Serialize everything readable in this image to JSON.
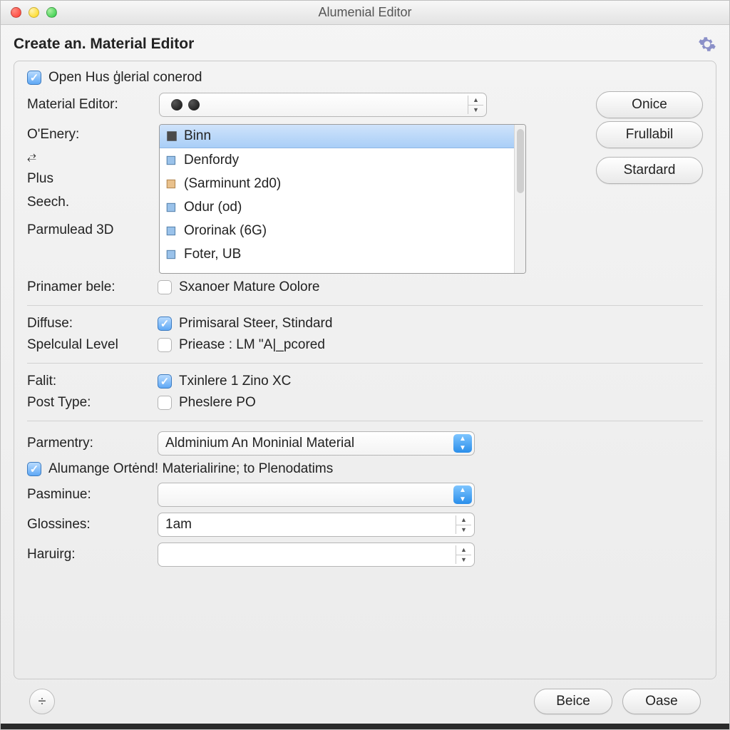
{
  "window": {
    "title": "Alumenial Editor"
  },
  "header": {
    "title": "Create an. Material Editor"
  },
  "top_checkbox": {
    "label": "Open Hus ģlerial conerod",
    "checked": true
  },
  "material_editor_row": {
    "label": "Material Editor:"
  },
  "right_buttons": {
    "onice": "Onice",
    "frullabil": "Frullabil",
    "stardard": "Stardard"
  },
  "left_labels": {
    "oenery": "O'Enery:",
    "glyph": "⥄",
    "plus": "Plus",
    "seech": "Seech.",
    "parmulead": "Parmulead 3D"
  },
  "listbox": {
    "items": [
      {
        "label": "Binn",
        "icon": "square"
      },
      {
        "label": "Denfordy",
        "icon": "cube"
      },
      {
        "label": "(Sarminunt 2d0)",
        "icon": "cube"
      },
      {
        "label": "Odur (od)",
        "icon": "cube"
      },
      {
        "label": "Ororinak (6G)",
        "icon": "cube"
      },
      {
        "label": "Foter, UB",
        "icon": "cube"
      }
    ]
  },
  "rows": {
    "prinamer": {
      "label": "Prinamer bele:",
      "text": "Sxanoer Mature Oolore",
      "checked": false
    },
    "diffuse": {
      "label": "Diffuse:",
      "text": "Primisaral Steer, Stindard",
      "checked": true
    },
    "spelculal": {
      "label": "Spelculal Level",
      "text": "Priease : LM \"A|_pcored",
      "checked": false
    },
    "falit": {
      "label": "Falit:",
      "text": "Txinlere 1 Zino XC",
      "checked": true
    },
    "posttype": {
      "label": "Post Type:",
      "text": "Pheslere PO",
      "checked": false
    },
    "parmentry": {
      "label": "Parmentry:",
      "value": "Aldminium An Moninial Material"
    },
    "alumange": {
      "label": "Alumange  Ortėnd! Materialirine; to Plenodatims",
      "checked": true
    },
    "pasminue": {
      "label": "Pasminue:",
      "value": ""
    },
    "glossines": {
      "label": "Glossines:",
      "value": "1am"
    },
    "haruirg": {
      "label": "Haruirg:",
      "value": ""
    }
  },
  "footer": {
    "beice": "Beice",
    "oase": "Oase"
  }
}
